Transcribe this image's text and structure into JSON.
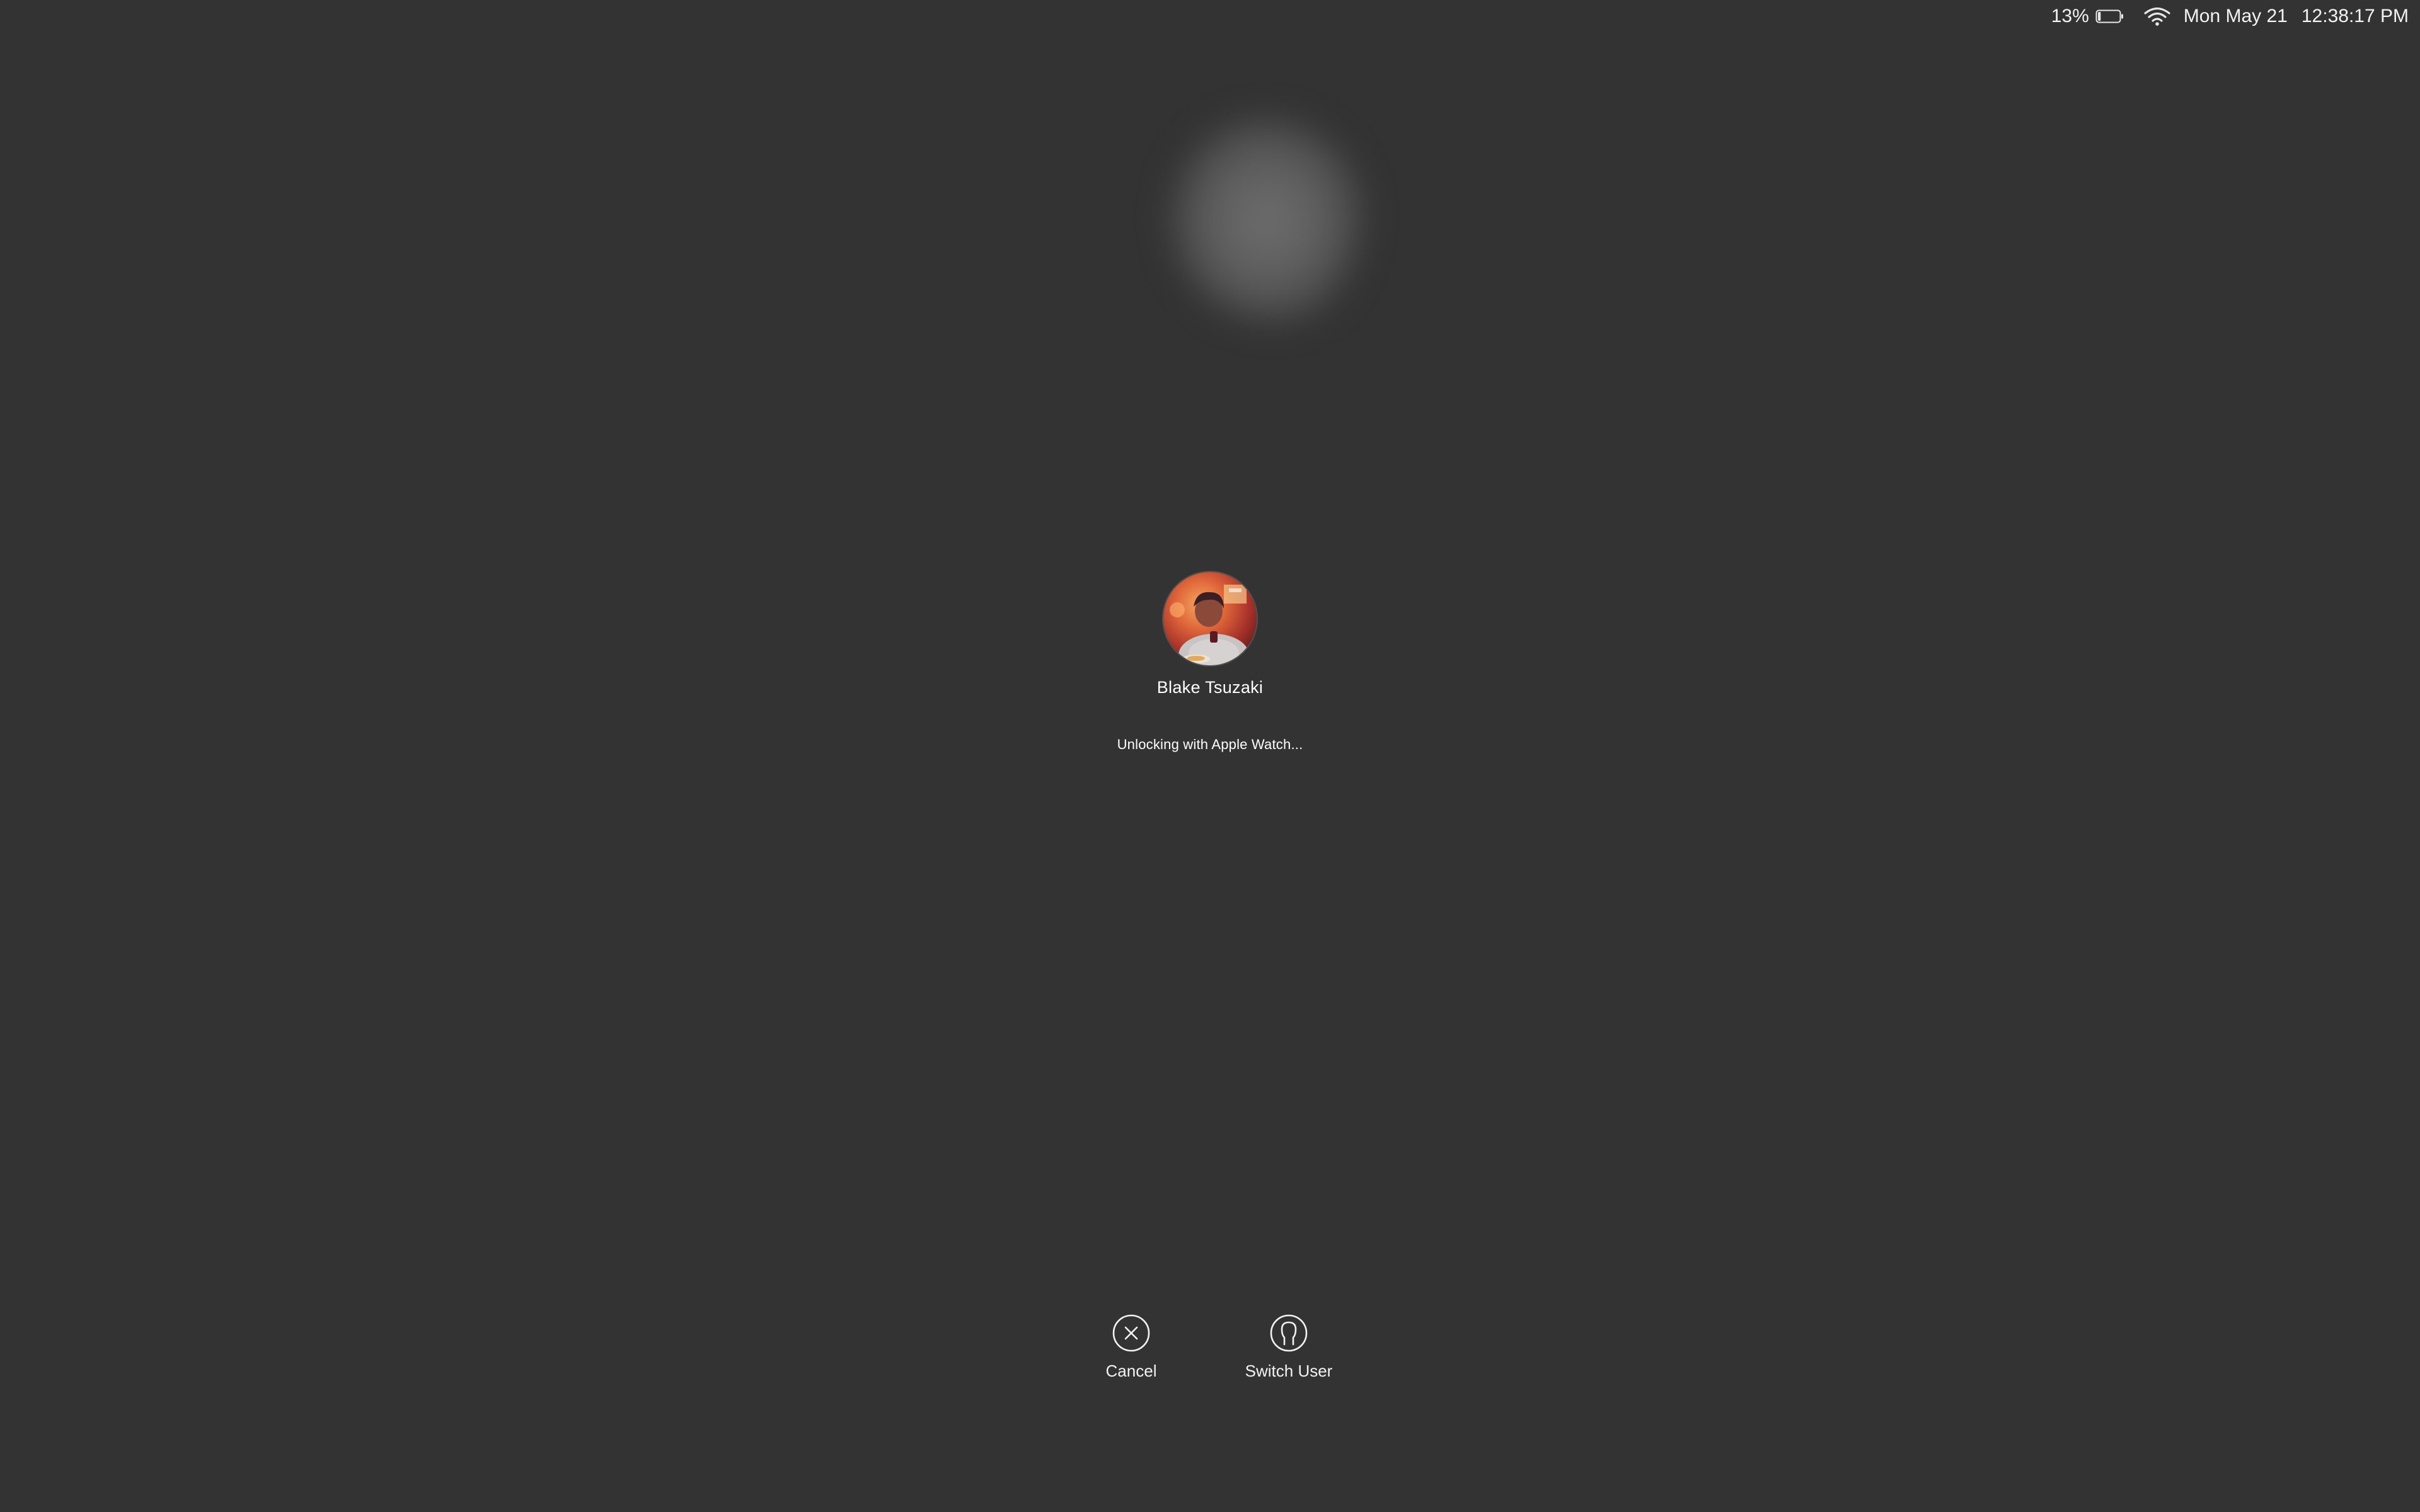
{
  "menubar": {
    "battery_percent": "13%",
    "battery_level": 0.13,
    "date": "Mon May 21",
    "time": "12:38:17 PM"
  },
  "user": {
    "name": "Blake Tsuzaki",
    "status": "Unlocking with Apple Watch..."
  },
  "actions": {
    "cancel_label": "Cancel",
    "switch_user_label": "Switch User"
  },
  "icons": {
    "battery": "battery-icon",
    "wifi": "wifi-icon",
    "cancel": "circle-x-icon",
    "switch_user": "user-silhouette-icon"
  },
  "colors": {
    "background": "#333333",
    "text": "#ffffff"
  }
}
